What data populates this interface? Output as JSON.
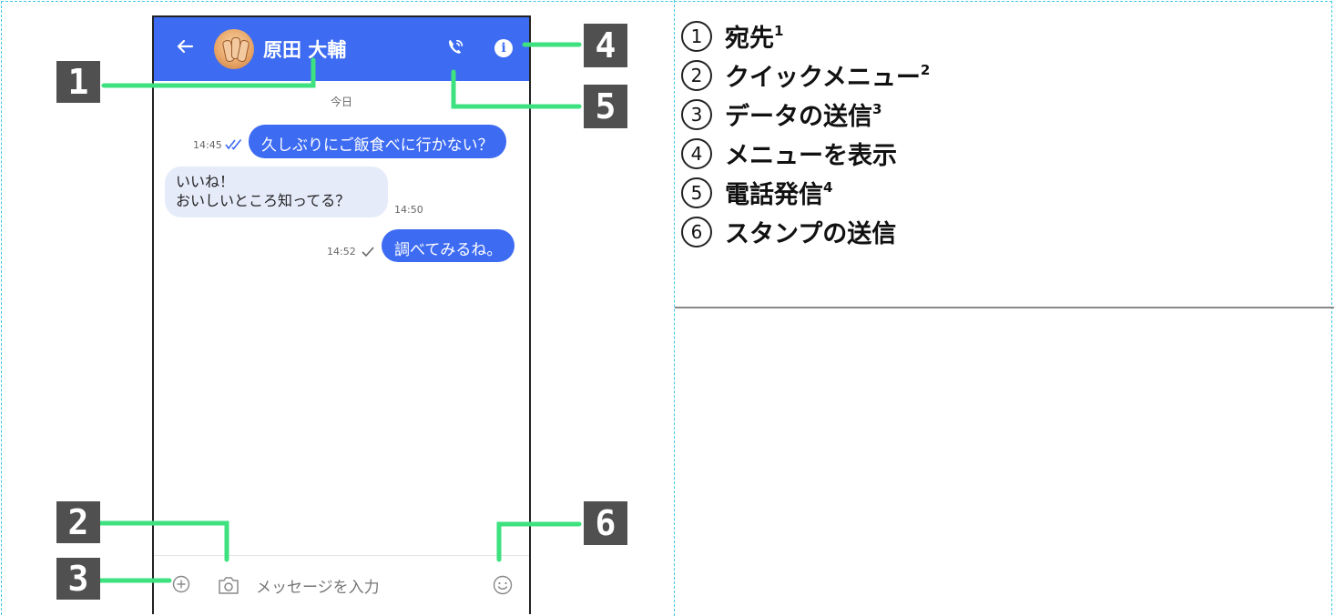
{
  "chat": {
    "contact_name": "原田 大輔",
    "date_label": "今日",
    "messages": [
      {
        "direction": "outgoing",
        "text": "久しぶりにご飯食べに行かない？",
        "time": "14:45",
        "status": "read"
      },
      {
        "direction": "incoming",
        "lines": [
          "いいね！",
          "おいしいところ知ってる？"
        ],
        "time": "14:50"
      },
      {
        "direction": "outgoing",
        "text": "調べてみるね。",
        "time": "14:52",
        "status": "sent"
      }
    ],
    "input_placeholder": "メッセージを入力",
    "colors": {
      "accent": "#3d6bf2",
      "incoming_bubble": "#e6ebfa",
      "callout_line": "#3ee17f",
      "badge": "#505050"
    },
    "icons": [
      "back-arrow-icon",
      "avatar",
      "phone-call-icon",
      "info-icon",
      "plus-icon",
      "camera-icon",
      "emoji-icon"
    ]
  },
  "callouts": [
    "1",
    "2",
    "3",
    "4",
    "5",
    "6"
  ],
  "legend": [
    {
      "num": "1",
      "label": "宛先",
      "note": "1"
    },
    {
      "num": "2",
      "label": "クイックメニュー",
      "note": "2"
    },
    {
      "num": "3",
      "label": "データの送信",
      "note": "3"
    },
    {
      "num": "4",
      "label": "メニューを表示",
      "note": ""
    },
    {
      "num": "5",
      "label": "電話発信",
      "note": "4"
    },
    {
      "num": "6",
      "label": "スタンプの送信",
      "note": ""
    }
  ]
}
